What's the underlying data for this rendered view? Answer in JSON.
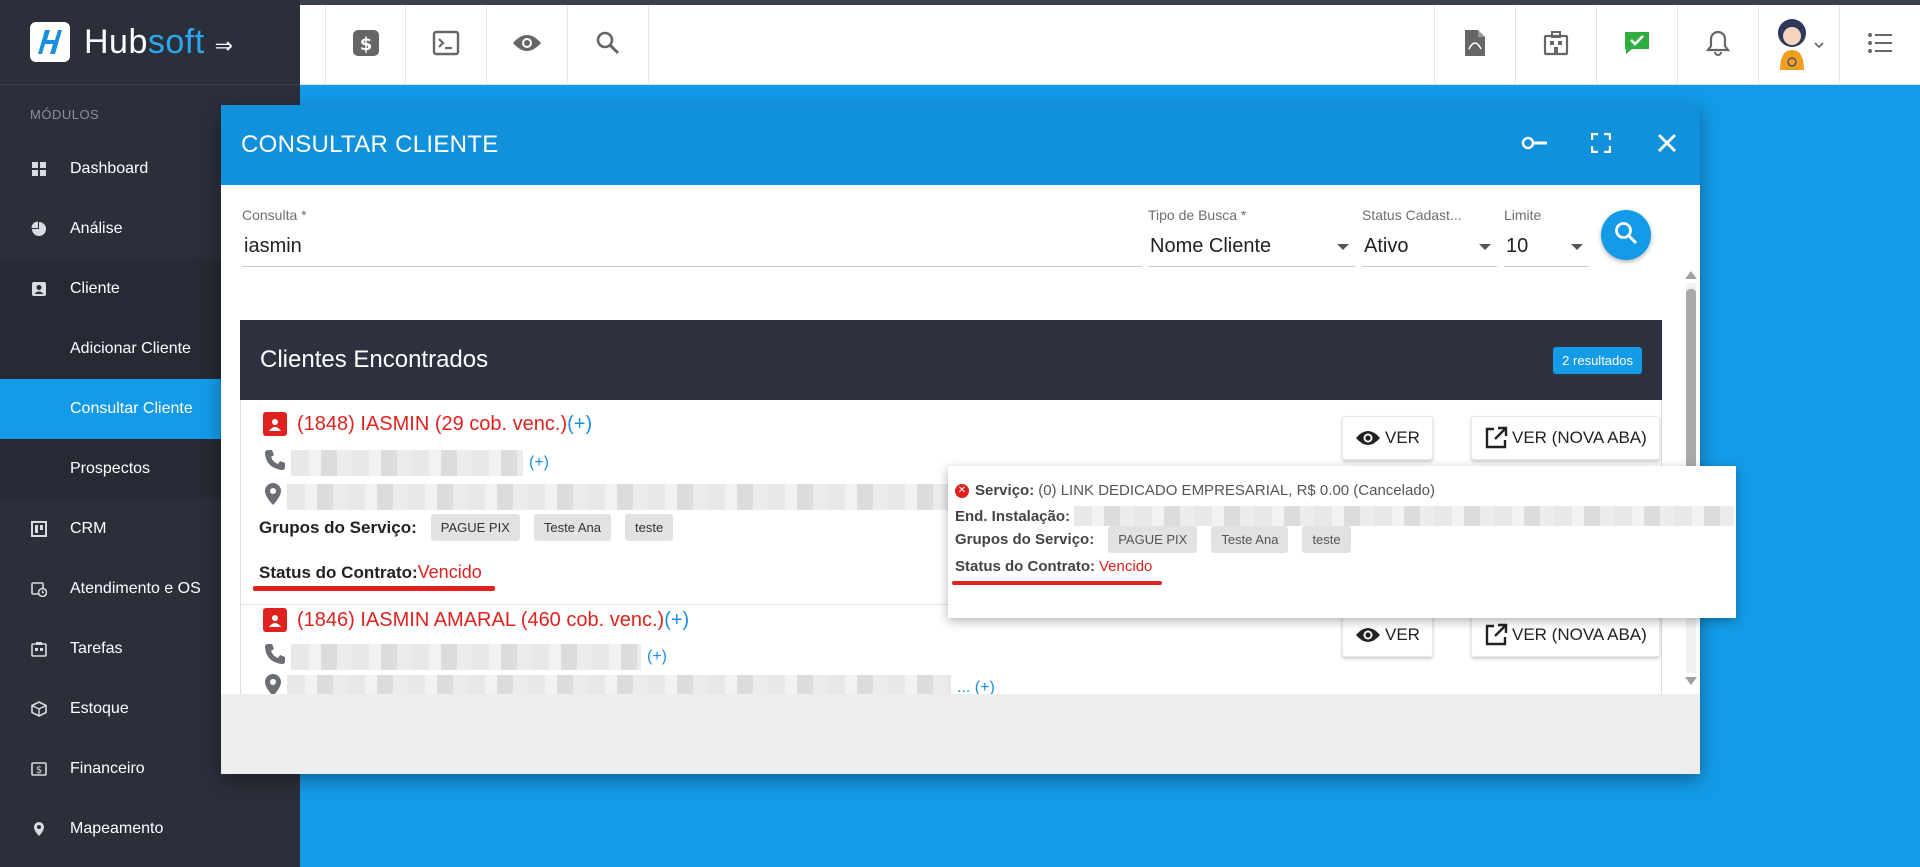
{
  "brand": {
    "name_part1": "Hub",
    "name_part2": "soft"
  },
  "sidebar": {
    "section_label": "MÓDULOS",
    "items": [
      {
        "label": "Dashboard",
        "icon": "dashboard-icon"
      },
      {
        "label": "Análise",
        "icon": "pie-chart-icon"
      },
      {
        "label": "Cliente",
        "icon": "contact-card-icon"
      },
      {
        "label": "Adicionar Cliente"
      },
      {
        "label": "Consultar Cliente"
      },
      {
        "label": "Prospectos"
      },
      {
        "label": "CRM",
        "icon": "kanban-icon"
      },
      {
        "label": "Atendimento e OS",
        "icon": "calendar-clock-icon"
      },
      {
        "label": "Tarefas",
        "icon": "tasks-icon"
      },
      {
        "label": "Estoque",
        "icon": "box-icon"
      },
      {
        "label": "Financeiro",
        "icon": "money-icon"
      },
      {
        "label": "Mapeamento",
        "icon": "map-pin-icon"
      }
    ]
  },
  "header": {
    "left_icons": [
      "dollar-icon",
      "terminal-icon",
      "eye-icon",
      "search-icon"
    ],
    "right_icons": [
      "pdf-icon",
      "building-icon",
      "chat-check-icon",
      "bell-icon",
      "avatar",
      "list-menu-icon"
    ]
  },
  "modal": {
    "title": "CONSULTAR CLIENTE",
    "form": {
      "consulta_label": "Consulta *",
      "consulta_value": "iasmin",
      "tipo_label": "Tipo de Busca *",
      "tipo_value": "Nome Cliente",
      "status_label": "Status Cadast...",
      "status_value": "Ativo",
      "limite_label": "Limite",
      "limite_value": "10"
    },
    "results": {
      "title": "Clientes Encontrados",
      "badge": "2 resultados",
      "clients": [
        {
          "name": "(1848) IASMIN (29 cob. venc.)",
          "plus": "(+)",
          "phone_plus": "(+)",
          "groups_label": "Grupos do Serviço:",
          "groups": [
            "PAGUE PIX",
            "Teste Ana",
            "teste"
          ],
          "status_label": "Status do Contrato:",
          "status_value": "Vencido",
          "btn_ver": "VER",
          "btn_ver_nova": "VER (NOVA ABA)"
        },
        {
          "name": "(1846) IASMIN AMARAL (460 cob. venc.)",
          "plus": "(+)",
          "phone_plus": "(+)",
          "address_plus": "... (+)",
          "btn_ver": "VER",
          "btn_ver_nova": "VER (NOVA ABA)"
        }
      ]
    },
    "popover": {
      "service_label": "Serviço:",
      "service_value": "(0) LINK DEDICADO EMPRESARIAL, R$ 0.00 (Cancelado)",
      "end_label": "End. Instalação:",
      "groups_label": "Grupos do Serviço:",
      "groups": [
        "PAGUE PIX",
        "Teste Ana",
        "teste"
      ],
      "status_label": "Status do Contrato:",
      "status_value": "Vencido"
    }
  },
  "colors": {
    "accent": "#139be8",
    "sidebar": "#2b2f3a",
    "danger": "#e0221f",
    "results_head": "#2d3140"
  }
}
